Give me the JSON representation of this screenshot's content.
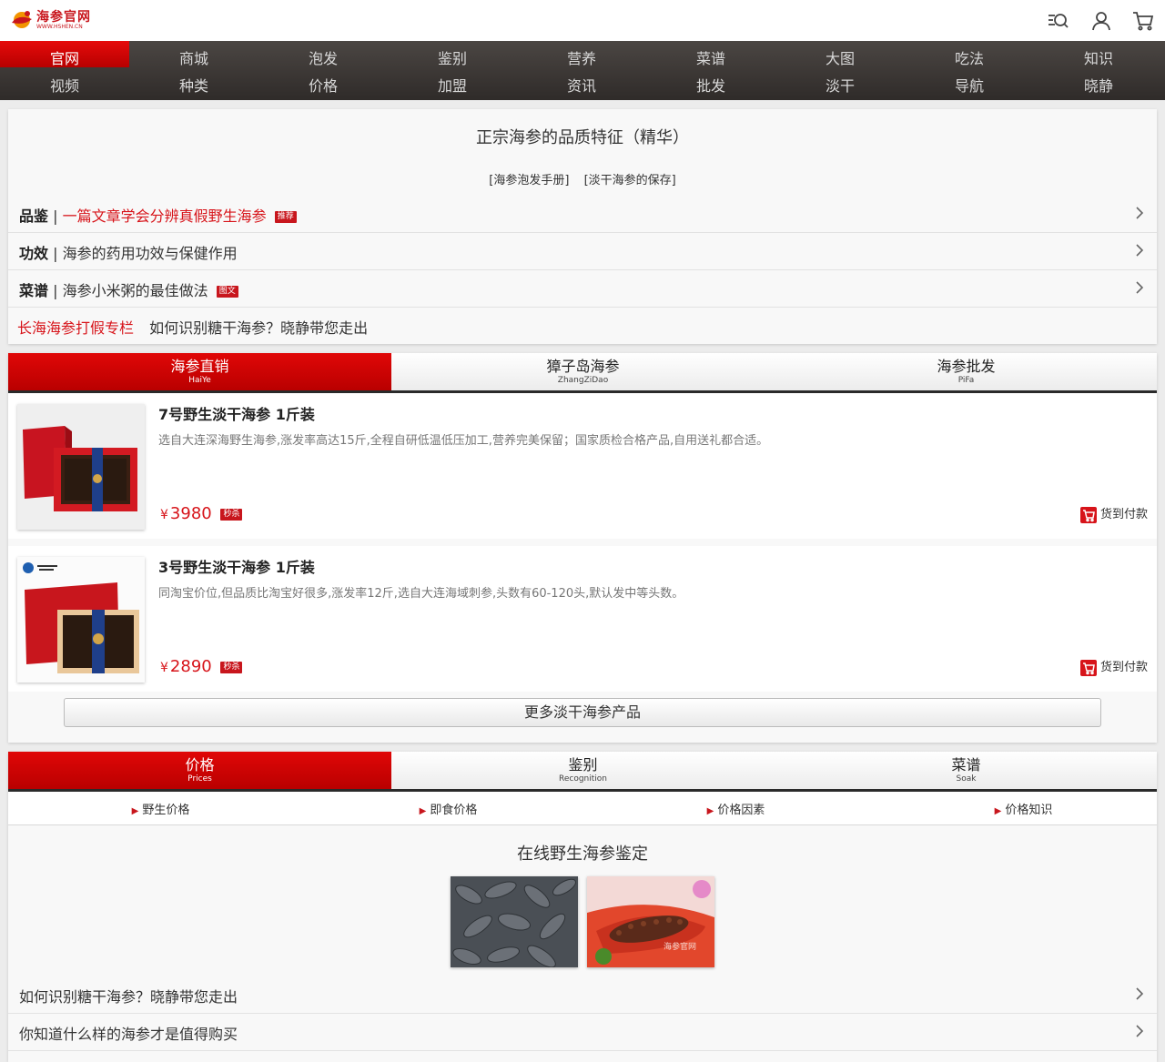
{
  "header": {
    "logo_text": "海参官网",
    "logo_sub": "WWW.HSHEN.CN",
    "icons": [
      "search-list-icon",
      "user-icon",
      "cart-icon"
    ]
  },
  "nav": {
    "columns": [
      {
        "top": "官网",
        "bottom": "视频"
      },
      {
        "top": "商城",
        "bottom": "种类"
      },
      {
        "top": "泡发",
        "bottom": "价格"
      },
      {
        "top": "鉴别",
        "bottom": "加盟"
      },
      {
        "top": "营养",
        "bottom": "资讯"
      },
      {
        "top": "菜谱",
        "bottom": "批发"
      },
      {
        "top": "大图",
        "bottom": "淡干"
      },
      {
        "top": "吃法",
        "bottom": "导航"
      },
      {
        "top": "知识",
        "bottom": "晓静"
      }
    ]
  },
  "intro": {
    "title": "正宗海参的品质特征（精华）",
    "links": [
      "[海参泡发手册]",
      "[淡干海参的保存]"
    ],
    "rows": [
      {
        "category": "品鉴",
        "text": "一篇文章学会分辨真假野生海参",
        "badge": "推荐"
      },
      {
        "category": "功效",
        "text": "海参的药用功效与保健作用",
        "badge": ""
      },
      {
        "category": "菜谱",
        "text": "海参小米粥的最佳做法",
        "badge": "图文"
      }
    ],
    "special_link": "长海海参打假专栏",
    "special_text": "如何识别糖干海参？晓静带您走出",
    "sep": "|"
  },
  "shop": {
    "tabs": [
      {
        "label": "海参直销",
        "sub": "HaiYe"
      },
      {
        "label": "獐子岛海参",
        "sub": "ZhangZiDao"
      },
      {
        "label": "海参批发",
        "sub": "PiFa"
      }
    ],
    "products": [
      {
        "title": "7号野生淡干海参 1斤装",
        "desc": "选自大连深海野生海参,涨发率高达15斤,全程自研低温低压加工,营养完美保留；国家质检合格产品,自用送礼都合适。",
        "currency": "¥",
        "price": "3980",
        "badge": "秒杀",
        "cod": "货到付款"
      },
      {
        "title": "3号野生淡干海参 1斤装",
        "desc": "同淘宝价位,但品质比淘宝好很多,涨发率12斤,选自大连海域刺参,头数有60-120头,默认发中等头数。",
        "currency": "¥",
        "price": "2890",
        "badge": "秒杀",
        "cod": "货到付款"
      }
    ],
    "more_button": "更多淡干海参产品"
  },
  "info": {
    "tabs": [
      {
        "label": "价格",
        "sub": "Prices"
      },
      {
        "label": "鉴别",
        "sub": "Recognition"
      },
      {
        "label": "菜谱",
        "sub": "Soak"
      }
    ],
    "subnav": [
      "野生价格",
      "即食价格",
      "价格因素",
      "价格知识"
    ],
    "title": "在线野生海参鉴定",
    "thumb_watermark": "海参官网",
    "articles": [
      "如何识别糖干海参？晓静带您走出",
      "你知道什么样的海参才是值得购买"
    ]
  },
  "colors": {
    "brand_red": "#c8161d",
    "nav_dark": "#3b3633",
    "price_red": "#d7141a"
  }
}
